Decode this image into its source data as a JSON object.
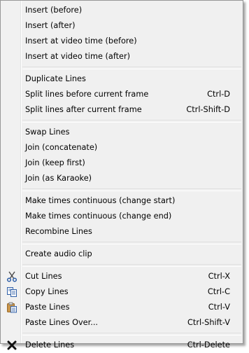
{
  "menu": {
    "items": [
      {
        "label": "Insert (before)",
        "shortcut": ""
      },
      {
        "label": "Insert (after)",
        "shortcut": ""
      },
      {
        "label": "Insert at video time (before)",
        "shortcut": ""
      },
      {
        "label": "Insert at video time (after)",
        "shortcut": ""
      },
      {
        "label": "Duplicate Lines",
        "shortcut": ""
      },
      {
        "label": "Split lines before current frame",
        "shortcut": "Ctrl-D"
      },
      {
        "label": "Split lines after current frame",
        "shortcut": "Ctrl-Shift-D"
      },
      {
        "label": "Swap Lines",
        "shortcut": ""
      },
      {
        "label": "Join (concatenate)",
        "shortcut": ""
      },
      {
        "label": "Join (keep first)",
        "shortcut": ""
      },
      {
        "label": "Join (as Karaoke)",
        "shortcut": ""
      },
      {
        "label": "Make times continuous (change start)",
        "shortcut": ""
      },
      {
        "label": "Make times continuous (change end)",
        "shortcut": ""
      },
      {
        "label": "Recombine Lines",
        "shortcut": ""
      },
      {
        "label": "Create audio clip",
        "shortcut": ""
      },
      {
        "label": "Cut Lines",
        "shortcut": "Ctrl-X",
        "icon": "scissors-icon"
      },
      {
        "label": "Copy Lines",
        "shortcut": "Ctrl-C",
        "icon": "copy-icon"
      },
      {
        "label": "Paste Lines",
        "shortcut": "Ctrl-V",
        "icon": "paste-icon"
      },
      {
        "label": "Paste Lines Over...",
        "shortcut": "Ctrl-Shift-V"
      },
      {
        "label": "Delete Lines",
        "shortcut": "Ctrl-Delete",
        "icon": "delete-x-icon"
      }
    ]
  },
  "colors": {
    "menu_background": "#f0f0f0",
    "menu_border": "#979797",
    "text": "#000000",
    "icon_blue": "#2f5fa8",
    "icon_brown": "#9a6a2a"
  }
}
